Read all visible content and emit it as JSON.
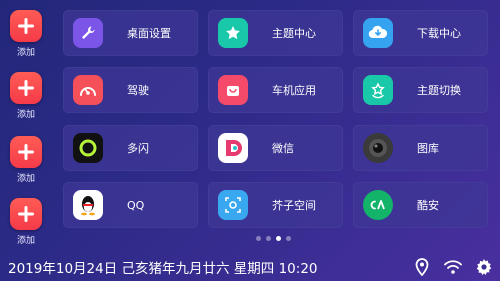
{
  "add_label": "添加",
  "apps": [
    {
      "label": "桌面设置",
      "icon": "wrench-icon",
      "color": "#7b55e8"
    },
    {
      "label": "主题中心",
      "icon": "star-icon",
      "color": "#19c8a8"
    },
    {
      "label": "下载中心",
      "icon": "cloud-download-icon",
      "color": "#36a3f0"
    },
    {
      "label": "驾驶",
      "icon": "speedometer-icon",
      "color": "#f5505a"
    },
    {
      "label": "车机应用",
      "icon": "shopping-bag-icon",
      "color": "#f54a6a"
    },
    {
      "label": "主题切换",
      "icon": "star-refresh-icon",
      "color": "#19c8a8"
    },
    {
      "label": "多闪",
      "icon": "duoshan-app-icon",
      "color": "#111111"
    },
    {
      "label": "微信",
      "icon": "wechat-app-icon",
      "color": "#ffffff"
    },
    {
      "label": "图库",
      "icon": "camera-lens-icon",
      "color": "#3a3a3a"
    },
    {
      "label": "QQ",
      "icon": "qq-penguin-icon",
      "color": "#ffffff"
    },
    {
      "label": "芥子空间",
      "icon": "jiezi-app-icon",
      "color": "#3aa8f0"
    },
    {
      "label": "酷安",
      "icon": "coolapk-icon",
      "color": "#13b36a"
    }
  ],
  "pager": {
    "count": 4,
    "active": 3
  },
  "status": {
    "datetime": "2019年10月24日 己亥猪年九月廿六 星期四 10:20",
    "icons": [
      "location-icon",
      "wifi-icon",
      "settings-gear-icon"
    ]
  }
}
